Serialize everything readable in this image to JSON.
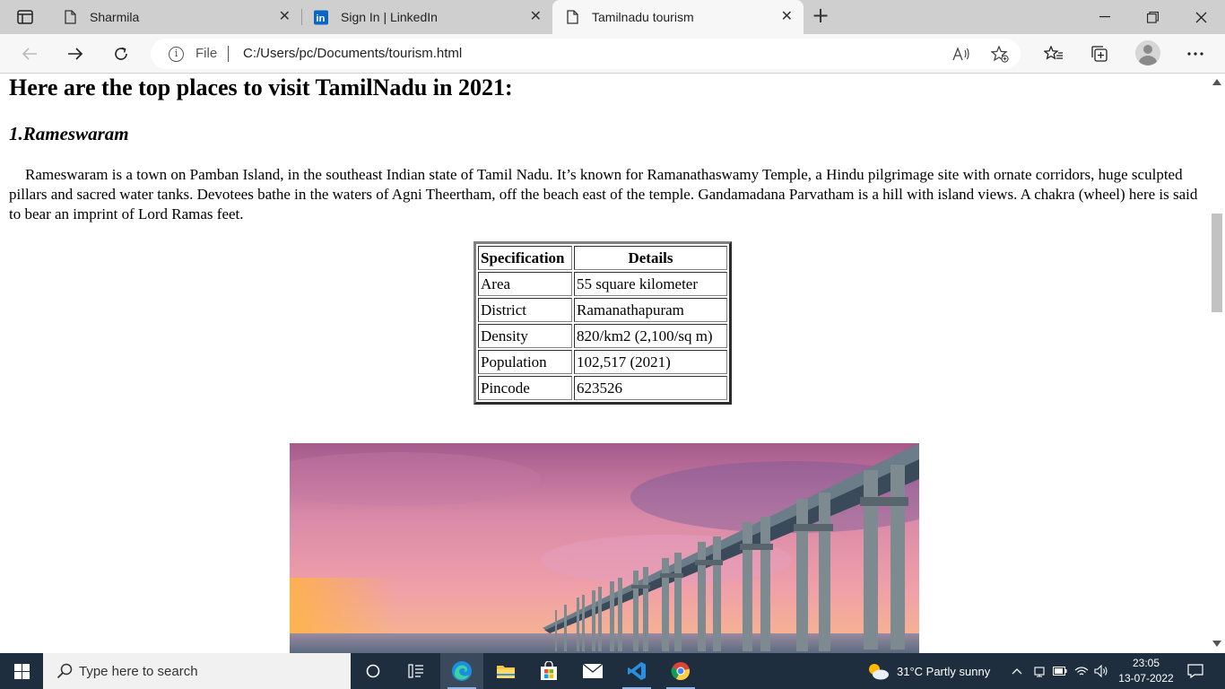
{
  "browser": {
    "tabs": [
      {
        "label": "Sharmila",
        "icon": "page-icon",
        "active": false
      },
      {
        "label": "Sign In | LinkedIn",
        "icon": "linkedin-icon",
        "active": false
      },
      {
        "label": "Tamilnadu tourism",
        "icon": "page-icon",
        "active": true
      }
    ],
    "address": {
      "protocol_label": "File",
      "url": "C:/Users/pc/Documents/tourism.html"
    }
  },
  "page": {
    "heading": "Here are the top places to visit TamilNadu in 2021:",
    "section_title": "1.Rameswaram",
    "description": "Rameswaram is a town on Pamban Island, in the southeast Indian state of Tamil Nadu. It’s known for Ramanathaswamy Temple, a Hindu pilgrimage site with ornate corridors, huge sculpted pillars and sacred water tanks. Devotees bathe in the waters of Agni Theertham, off the beach east of the temple. Gandamadana Parvatham is a hill with island views. A chakra (wheel) here is said to bear an imprint of Lord Ramas feet.",
    "table": {
      "headers": [
        "Specification",
        "Details"
      ],
      "rows": [
        [
          "Area",
          "55 square kilometer"
        ],
        [
          "District",
          "Ramanathapuram"
        ],
        [
          "Density",
          "820/km2 (2,100/sq m)"
        ],
        [
          "Population",
          "102,517 (2021)"
        ],
        [
          "Pincode",
          "623526"
        ]
      ]
    }
  },
  "taskbar": {
    "search_placeholder": "Type here to search",
    "weather": "31°C  Partly sunny",
    "time": "23:05",
    "date": "13-07-2022"
  },
  "colors": {
    "taskbar_bg": "#1e2e3e",
    "tabstrip_bg": "#cfcfcf",
    "active_tab_bg": "#f7f7f7",
    "linkedin_blue": "#0a66c2"
  }
}
